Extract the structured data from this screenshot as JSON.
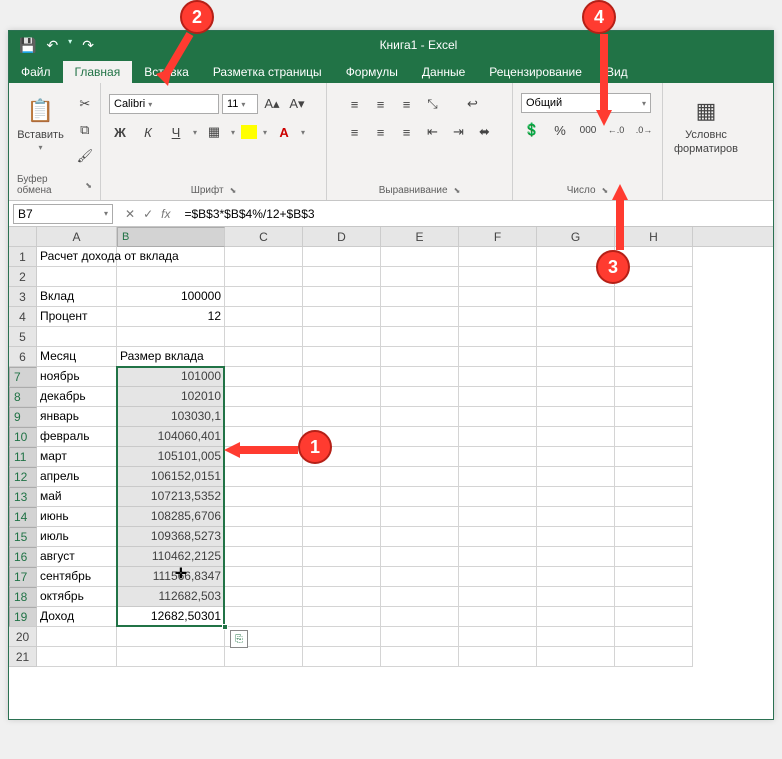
{
  "title": "Книга1 - Excel",
  "qat": {
    "save": "💾",
    "undo": "↶",
    "redo": "↷"
  },
  "tabs": {
    "file": "Файл",
    "home": "Главная",
    "insert": "Вставка",
    "layout": "Разметка страницы",
    "formulas": "Формулы",
    "data": "Данные",
    "review": "Рецензирование",
    "view": "Вид"
  },
  "ribbon": {
    "clipboard": {
      "paste": "Вставить",
      "label": "Буфер обмена"
    },
    "font": {
      "name": "Calibri",
      "size": "11",
      "label": "Шрифт"
    },
    "alignment": {
      "label": "Выравнивание"
    },
    "number": {
      "format": "Общий",
      "label": "Число"
    },
    "styles": {
      "condfmt": "Условнс",
      "condfmt2": "форматиров"
    }
  },
  "formula_bar": {
    "namebox": "B7",
    "formula": "=$B$3*$B$4%/12+$B$3"
  },
  "columns": [
    "A",
    "B",
    "C",
    "D",
    "E",
    "F",
    "G",
    "H"
  ],
  "rows": [
    {
      "n": 1,
      "A": "Расчет дохода от вклада"
    },
    {
      "n": 2
    },
    {
      "n": 3,
      "A": "Вклад",
      "B": "100000"
    },
    {
      "n": 4,
      "A": "Процент",
      "B": "12"
    },
    {
      "n": 5
    },
    {
      "n": 6,
      "A": "Месяц",
      "B": "Размер вклада"
    },
    {
      "n": 7,
      "A": "ноябрь",
      "B": "101000"
    },
    {
      "n": 8,
      "A": "декабрь",
      "B": "102010"
    },
    {
      "n": 9,
      "A": "январь",
      "B": "103030,1"
    },
    {
      "n": 10,
      "A": "февраль",
      "B": "104060,401"
    },
    {
      "n": 11,
      "A": "март",
      "B": "105101,005"
    },
    {
      "n": 12,
      "A": "апрель",
      "B": "106152,0151"
    },
    {
      "n": 13,
      "A": "май",
      "B": "107213,5352"
    },
    {
      "n": 14,
      "A": "июнь",
      "B": "108285,6706"
    },
    {
      "n": 15,
      "A": "июль",
      "B": "109368,5273"
    },
    {
      "n": 16,
      "A": "август",
      "B": "110462,2125"
    },
    {
      "n": 17,
      "A": "сентябрь",
      "B": "111566,8347"
    },
    {
      "n": 18,
      "A": "октябрь",
      "B": "112682,503"
    },
    {
      "n": 19,
      "A": "Доход",
      "B": "12682,50301"
    },
    {
      "n": 20
    },
    {
      "n": 21
    }
  ],
  "callouts": {
    "c1": "1",
    "c2": "2",
    "c3": "3",
    "c4": "4"
  }
}
